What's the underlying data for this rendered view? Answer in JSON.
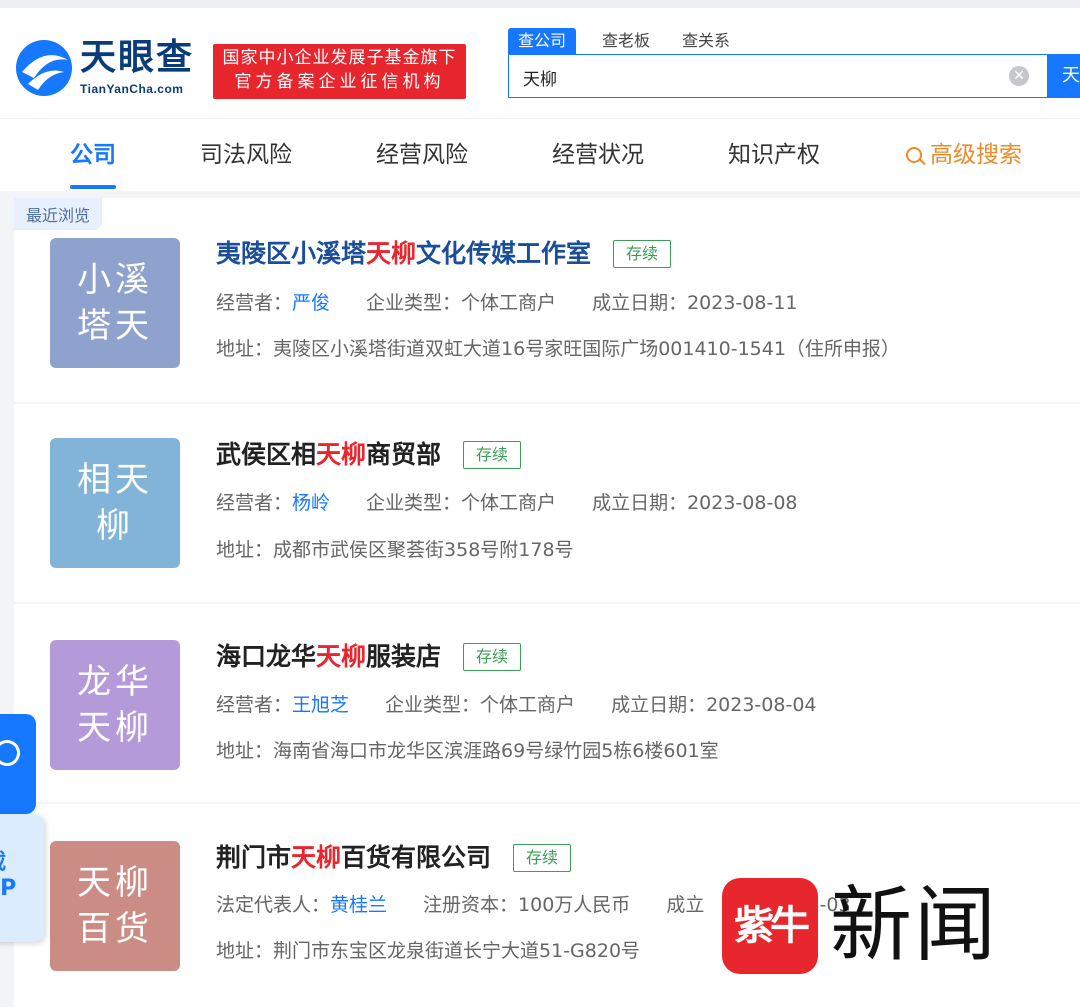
{
  "header": {
    "logo_text": "天眼查",
    "logo_sub": "TianYanCha.com",
    "slogan_line1": "国家中小企业发展子基金旗下",
    "slogan_line2": "官方备案企业征信机构",
    "search_tabs": [
      "查公司",
      "查老板",
      "查关系"
    ],
    "search_value": "天柳",
    "search_button": "天"
  },
  "nav": {
    "items": [
      "公司",
      "司法风险",
      "经营风险",
      "经营状况",
      "知识产权"
    ],
    "advanced": "高级搜索"
  },
  "recent_label": "最近浏览",
  "results": [
    {
      "avatar": "小溪塔天",
      "avatar_color": "#8fa1cd",
      "name_pre": "夷陵区小溪塔",
      "name_hl": "天柳",
      "name_post": "文化传媒工作室",
      "status": "存续",
      "person_label": "经营者：",
      "person": "严俊",
      "f2_label": "企业类型：",
      "f2_value": "个体工商户",
      "date_label": "成立日期：",
      "date": "2023-08-11",
      "addr_label": "地址：",
      "address": "夷陵区小溪塔街道双虹大道16号家旺国际广场001410-1541（住所申报）"
    },
    {
      "avatar": "相天柳",
      "avatar_color": "#82b3d9",
      "name_pre": "武侯区相",
      "name_hl": "天柳",
      "name_post": "商贸部",
      "status": "存续",
      "person_label": "经营者：",
      "person": "杨岭",
      "f2_label": "企业类型：",
      "f2_value": "个体工商户",
      "date_label": "成立日期：",
      "date": "2023-08-08",
      "addr_label": "地址：",
      "address": "成都市武侯区聚荟街358号附178号"
    },
    {
      "avatar": "龙华天柳",
      "avatar_color": "#b49ad9",
      "name_pre": "海口龙华",
      "name_hl": "天柳",
      "name_post": "服装店",
      "status": "存续",
      "person_label": "经营者：",
      "person": "王旭芝",
      "f2_label": "企业类型：",
      "f2_value": "个体工商户",
      "date_label": "成立日期：",
      "date": "2023-08-04",
      "addr_label": "地址：",
      "address": "海南省海口市龙华区滨涯路69号绿竹园5栋6楼601室"
    },
    {
      "avatar": "天柳百货",
      "avatar_color": "#cc8c86",
      "name_pre": "荆门市",
      "name_hl": "天柳",
      "name_post": "百货有限公司",
      "status": "存续",
      "person_label": "法定代表人：",
      "person": "黄桂兰",
      "f2_label": "注册资本：",
      "f2_value": "100万人民币",
      "date_label": "成立",
      "date": "23-08-03",
      "addr_label": "地址：",
      "address": "荆门市东宝区龙泉街道长宁大道51-G820号"
    }
  ],
  "float_download": [
    "载",
    "PP"
  ],
  "watermark": {
    "logo": "紫牛",
    "text": "新闻"
  },
  "colors": {
    "primary": "#1677ff",
    "highlight": "#e8262d",
    "status": "#3a9e56",
    "advanced": "#f08a24"
  }
}
